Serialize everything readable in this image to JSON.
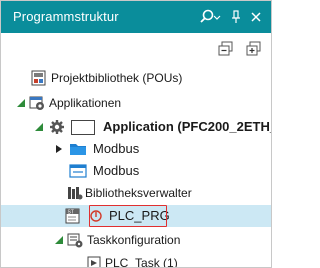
{
  "panel": {
    "title": "Programmstruktur"
  },
  "tree": {
    "projektbibliothek": "Projektbibliothek (POUs)",
    "applikationen": "Applikationen",
    "application": "Application (PFC200_2ETH_",
    "modbus_folder": "Modbus",
    "modbus_item": "Modbus",
    "bibliotheksverwalter": "Bibliotheksverwalter",
    "plc_prg": "PLC_PRG",
    "taskkonfiguration": "Taskkonfiguration",
    "plc_task": "PLC_Task (1)"
  },
  "colors": {
    "titlebar": "#0a8d9b",
    "selection": "#cce8f4",
    "highlight_border": "#e03030",
    "expander_green": "#2e8b3a"
  },
  "icons": {
    "search": "search-icon",
    "pin": "pin-icon",
    "close": "close-icon",
    "collapse_all": "collapse-all-icon",
    "expand_all": "expand-all-icon"
  }
}
